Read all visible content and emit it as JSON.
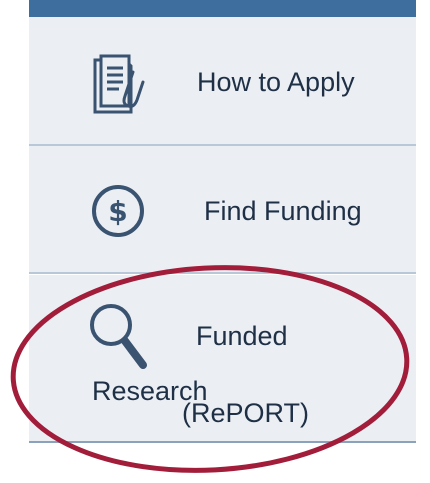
{
  "nav": {
    "items": [
      {
        "label": "How to Apply",
        "icon": "document-paperclip-icon"
      },
      {
        "label": "Find Funding",
        "icon": "dollar-circle-icon"
      },
      {
        "label_line1": "Funded",
        "label_line2": "Research",
        "label_line3": "(RePORT)",
        "icon": "magnifier-icon"
      }
    ]
  },
  "colors": {
    "topbar": "#3e6e9e",
    "item_bg": "#ebeff4",
    "text": "#1f3046",
    "icon": "#3a5370",
    "highlight": "#a11d3a"
  }
}
